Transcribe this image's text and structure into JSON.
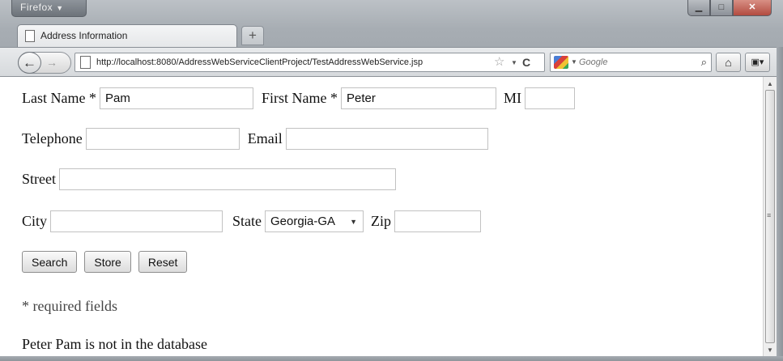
{
  "browser": {
    "menu_label": "Firefox",
    "tab_title": "Address Information",
    "new_tab_symbol": "+",
    "url": "http://localhost:8080/AddressWebServiceClientProject/TestAddressWebService.jsp",
    "search_placeholder": "Google"
  },
  "form": {
    "last_name_label": "Last Name *",
    "last_name_value": "Pam",
    "first_name_label": "First Name *",
    "first_name_value": "Peter",
    "mi_label": "MI",
    "mi_value": "",
    "telephone_label": "Telephone",
    "telephone_value": "",
    "email_label": "Email",
    "email_value": "",
    "street_label": "Street",
    "street_value": "",
    "city_label": "City",
    "city_value": "",
    "state_label": "State",
    "state_selected": "Georgia-GA",
    "zip_label": "Zip",
    "zip_value": ""
  },
  "buttons": {
    "search": "Search",
    "store": "Store",
    "reset": "Reset"
  },
  "notes": {
    "required": "* required fields",
    "status": "Peter Pam is not in the database"
  }
}
